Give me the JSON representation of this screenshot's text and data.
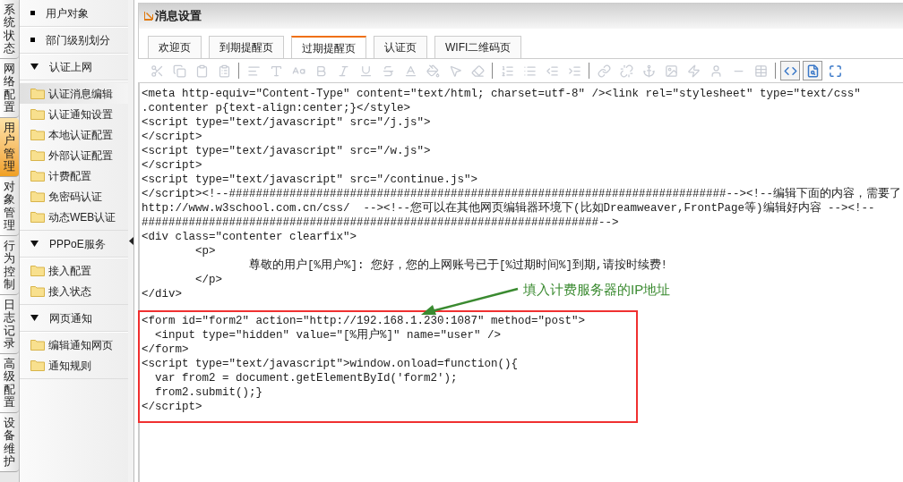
{
  "side_tabs": [
    {
      "label": "系统状态",
      "selected": false
    },
    {
      "label": "网络配置",
      "selected": false
    },
    {
      "label": "用户管理",
      "selected": true
    },
    {
      "label": "对象管理",
      "selected": false
    },
    {
      "label": "行为控制",
      "selected": false
    },
    {
      "label": "日志记录",
      "selected": false
    },
    {
      "label": "高级配置",
      "selected": false
    },
    {
      "label": "设备维护",
      "selected": false
    }
  ],
  "menu": [
    {
      "kind": "link",
      "label": "用户对象"
    },
    {
      "kind": "link",
      "label": "部门级别划分"
    },
    {
      "kind": "group",
      "label": "认证上网",
      "expanded": true,
      "children": [
        {
          "label": "认证消息编辑",
          "selected": true
        },
        {
          "label": "认证通知设置",
          "selected": false
        },
        {
          "label": "本地认证配置",
          "selected": false
        },
        {
          "label": "外部认证配置",
          "selected": false
        },
        {
          "label": "计费配置",
          "selected": false
        },
        {
          "label": "免密码认证",
          "selected": false
        },
        {
          "label": "动态WEB认证",
          "selected": false
        }
      ]
    },
    {
      "kind": "group",
      "label": "PPPoE服务",
      "expanded": true,
      "children": [
        {
          "label": "接入配置",
          "selected": false
        },
        {
          "label": "接入状态",
          "selected": false
        }
      ]
    },
    {
      "kind": "group",
      "label": "网页通知",
      "expanded": true,
      "children": [
        {
          "label": "编辑通知网页",
          "selected": false
        },
        {
          "label": "通知规则",
          "selected": false
        }
      ]
    }
  ],
  "panel": {
    "title": "消息设置",
    "tabs": [
      {
        "label": "欢迎页",
        "selected": false
      },
      {
        "label": "到期提醒页",
        "selected": false
      },
      {
        "label": "过期提醒页",
        "selected": true
      },
      {
        "label": "认证页",
        "selected": false
      },
      {
        "label": "WIFI二维码页",
        "selected": false
      }
    ],
    "toolbar": [
      [
        {
          "kind": "cut",
          "disabled": true,
          "selected": false
        },
        {
          "kind": "copy",
          "disabled": true,
          "selected": false
        },
        {
          "kind": "paste",
          "disabled": true,
          "selected": false
        },
        {
          "kind": "paste-text",
          "disabled": true,
          "selected": false
        }
      ],
      [
        {
          "kind": "align",
          "disabled": true,
          "selected": false
        },
        {
          "kind": "font",
          "disabled": true,
          "selected": false
        },
        {
          "kind": "font-size",
          "disabled": true,
          "selected": false
        },
        {
          "kind": "bold",
          "disabled": true,
          "selected": false
        },
        {
          "kind": "italic",
          "disabled": true,
          "selected": false
        },
        {
          "kind": "underline",
          "disabled": true,
          "selected": false
        },
        {
          "kind": "strike",
          "disabled": true,
          "selected": false
        },
        {
          "kind": "text-color",
          "disabled": true,
          "selected": false
        },
        {
          "kind": "highlight",
          "disabled": true,
          "selected": false
        },
        {
          "kind": "select",
          "disabled": true,
          "selected": false
        },
        {
          "kind": "eraser",
          "disabled": true,
          "selected": false
        }
      ],
      [
        {
          "kind": "ordered-list",
          "disabled": true,
          "selected": false
        },
        {
          "kind": "bullet-list",
          "disabled": true,
          "selected": false
        },
        {
          "kind": "outdent",
          "disabled": true,
          "selected": false
        },
        {
          "kind": "indent",
          "disabled": true,
          "selected": false
        }
      ],
      [
        {
          "kind": "link",
          "disabled": true,
          "selected": false
        },
        {
          "kind": "unlink",
          "disabled": true,
          "selected": false
        },
        {
          "kind": "anchor",
          "disabled": true,
          "selected": false
        },
        {
          "kind": "image",
          "disabled": true,
          "selected": false
        },
        {
          "kind": "flash",
          "disabled": true,
          "selected": false
        },
        {
          "kind": "user",
          "disabled": true,
          "selected": false
        },
        {
          "kind": "rule",
          "disabled": true,
          "selected": false
        },
        {
          "kind": "table",
          "disabled": true,
          "selected": false
        }
      ],
      [
        {
          "kind": "source",
          "disabled": false,
          "selected": true
        },
        {
          "kind": "preview",
          "disabled": false,
          "selected": true
        },
        {
          "kind": "maximize",
          "disabled": false,
          "selected": false
        }
      ]
    ],
    "code_blocks": [
      {
        "highlighted": false,
        "lines": [
          "<meta http-equiv=\"Content-Type\" content=\"text/html; charset=utf-8\" /><link rel=\"stylesheet\" type=\"text/css\"",
          ".contenter p{text-align:center;}</style>",
          "<script type=\"text/javascript\" src=\"/j.js\">",
          "</script>",
          "<script type=\"text/javascript\" src=\"/w.js\">",
          "</script>",
          "<script type=\"text/javascript\" src=\"/continue.js\">",
          "</script><!--##########################################################################--><!--编辑下面的内容，需要了",
          "http://www.w3school.com.cn/css/  --><!--您可以在其他网页编辑器环境下(比如Dreamweaver,FrontPage等)编辑好内容 --><!--",
          "####################################################################-->",
          "<div class=\"contenter clearfix\">",
          "        <p>",
          "                尊敬的用户[%用户%]: 您好，您的上网账号已于[%过期时间%]到期,请按时续费!",
          "        </p>",
          "</div>"
        ]
      },
      {
        "highlighted": true,
        "lines": [
          "<form id=\"form2\" action=\"http://192.168.1.230:1087\" method=\"post\">",
          "  <input type=\"hidden\" value=\"[%用户%]\" name=\"user\" />",
          "</form>",
          "<script type=\"text/javascript\">window.onload=function(){",
          "  var from2 = document.getElementById('form2');",
          "  from2.submit();}",
          "</script>"
        ]
      }
    ],
    "annotation": "填入计费服务器的IP地址"
  }
}
